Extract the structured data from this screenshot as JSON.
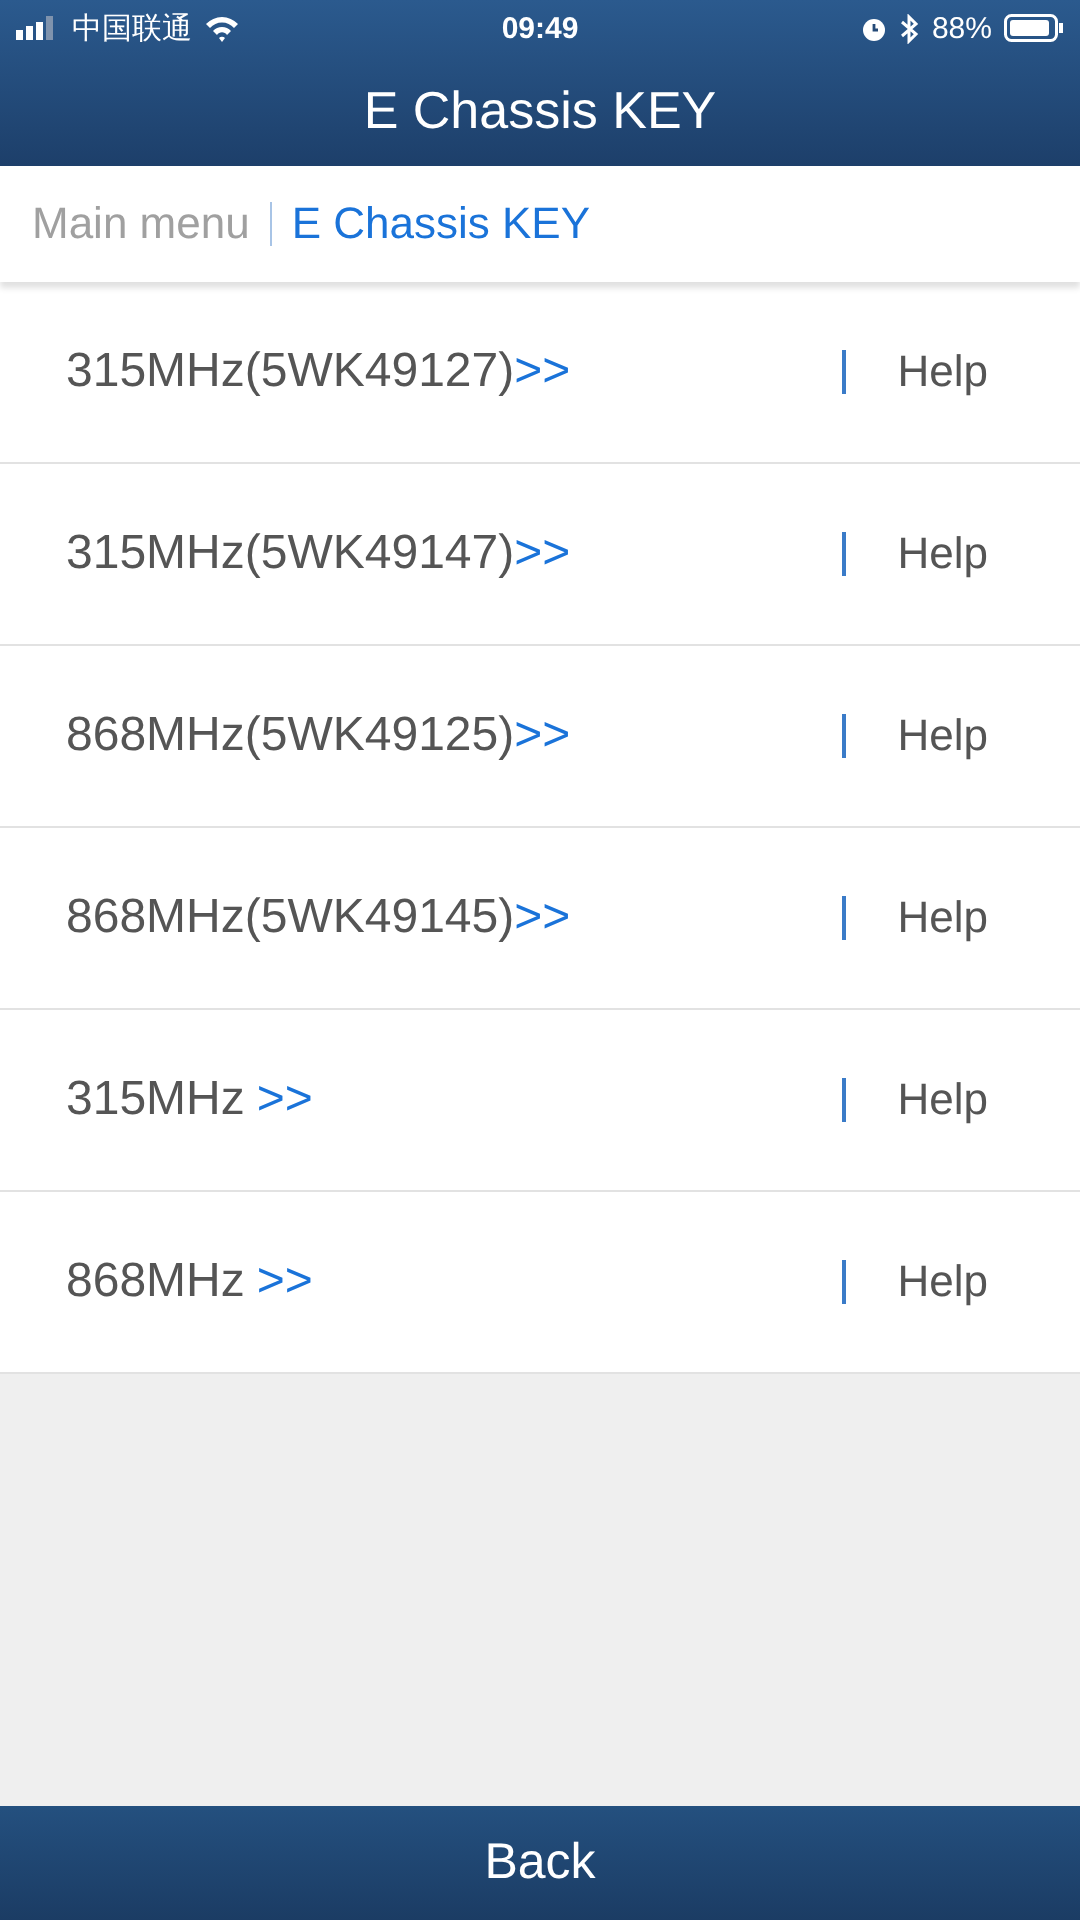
{
  "status_bar": {
    "carrier": "中国联通",
    "time": "09:49",
    "battery": "88%"
  },
  "header": {
    "title": "E Chassis KEY"
  },
  "breadcrumb": [
    {
      "label": "Main menu",
      "selected": false
    },
    {
      "label": "E Chassis KEY",
      "selected": true
    }
  ],
  "items": [
    {
      "label": "315MHz(5WK49127)",
      "arrow": ">>",
      "spaced": false,
      "help": "Help"
    },
    {
      "label": "315MHz(5WK49147)",
      "arrow": ">>",
      "spaced": false,
      "help": "Help"
    },
    {
      "label": "868MHz(5WK49125)",
      "arrow": ">>",
      "spaced": false,
      "help": "Help"
    },
    {
      "label": "868MHz(5WK49145)",
      "arrow": ">>",
      "spaced": false,
      "help": "Help"
    },
    {
      "label": "315MHz",
      "arrow": ">>",
      "spaced": true,
      "help": "Help"
    },
    {
      "label": "868MHz",
      "arrow": ">>",
      "spaced": true,
      "help": "Help"
    }
  ],
  "footer": {
    "button": "Back"
  }
}
